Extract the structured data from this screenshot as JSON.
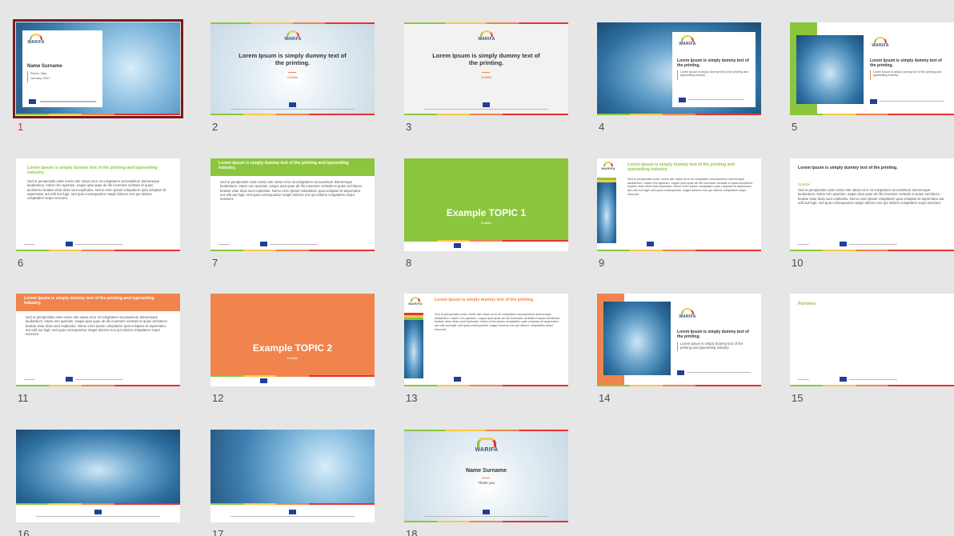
{
  "slides": [
    {
      "n": "1",
      "name": "Name Surname",
      "lines": [
        "Rome, Italy",
        "January 2021"
      ],
      "logo": "WARIFA"
    },
    {
      "n": "2",
      "title": "Lorem Ipsum is simply dummy text of the printing.",
      "sub": "Subtitle",
      "logo": "WARIFA"
    },
    {
      "n": "3",
      "title": "Lorem Ipsum is simply dummy text of the printing.",
      "sub": "Subtitle",
      "logo": "WARIFA"
    },
    {
      "n": "4",
      "title": "Lorem Ipsum is simply dummy text of the printing.",
      "body": "Lorem Ipsum is simply dummy text of the printing and typesetting industry.",
      "logo": "WARIFA"
    },
    {
      "n": "5",
      "title": "Lorem Ipsum is simply dummy text of the printing.",
      "body": "Lorem Ipsum is simply dummy text of the printing and typesetting industry.",
      "logo": "WARIFA"
    },
    {
      "n": "6",
      "title": "Lorem Ipsum is simply dummy text of the printing and typesetting industry.",
      "body": "Sed ut perspiciatis unde omnis iste natus error sit voluptatem accusantium doloremque laudantium, totam rem aperiam, eaque ipsa quae ab illo inventore veritatis et quasi architecto beatae vitae dicta sunt explicabo. Nemo enim ipsam voluptatem quia voluptas sit aspernatur aut odit aut fugit, sed quia consequuntur magni dolores eos qui ratione voluptatem sequi nesciunt."
    },
    {
      "n": "7",
      "title": "Lorem Ipsum is simply dummy text of the printing and typesetting industry.",
      "body": "Sed ut perspiciatis unde omnis iste natus error sit voluptatem accusantium doloremque laudantium, totam rem aperiam, eaque ipsa quae ab illo inventore veritatis et quasi architecto beatae vitae dicta sunt explicabo. Nemo enim ipsam voluptatem quia voluptas sit aspernatur aut odit aut fugit, sed quia consequuntur magni dolores eos qui ratione voluptatem sequi nesciunt."
    },
    {
      "n": "8",
      "title": "Example TOPIC 1",
      "sub": "Subtitle"
    },
    {
      "n": "9",
      "title": "Lorem Ipsum is simply dummy text of the printing and typesetting industry.",
      "logo": "WARIFA"
    },
    {
      "n": "10",
      "title": "Lorem Ipsum is simply dummy text of the printing.",
      "sub": "Subtitle",
      "body": "Sed ut perspiciatis unde omnis iste natus error sit voluptatem accusantium doloremque laudantium, totam rem aperiam, eaque ipsa quae ab illo inventore veritatis et quasi architecto beatae vitae dicta sunt explicabo. Nemo enim ipsam voluptatem quia voluptas sit aspernatur aut odit aut fugit, sed quia consequuntur magni dolores eos qui ratione voluptatem sequi nesciunt."
    },
    {
      "n": "11",
      "title": "Lorem Ipsum is simply dummy text of the printing and typesetting industry.",
      "body": "Sed ut perspiciatis unde omnis iste natus error sit voluptatem accusantium doloremque laudantium, totam rem aperiam, eaque ipsa quae ab illo inventore veritatis et quasi architecto beatae vitae dicta sunt explicabo. Nemo enim ipsam voluptatem quia voluptas sit aspernatur aut odit aut fugit, sed quia consequuntur magni dolores eos qui ratione voluptatem sequi nesciunt."
    },
    {
      "n": "12",
      "title": "Example TOPIC 2",
      "sub": "Subtitle"
    },
    {
      "n": "13",
      "title": "Lorem Ipsum is simply dummy text of the printing.",
      "logo": "WARIFA"
    },
    {
      "n": "14",
      "title": "Lorem Ipsum is simply dummy text of the printing.",
      "body": "Lorem Ipsum is simply dummy text of the printing and typesetting industry.",
      "logo": "WARIFA"
    },
    {
      "n": "15",
      "title": "Partners"
    },
    {
      "n": "16"
    },
    {
      "n": "17"
    },
    {
      "n": "18",
      "name": "Name Surname",
      "sub": "Thank you",
      "logo": "WARIFA"
    }
  ]
}
